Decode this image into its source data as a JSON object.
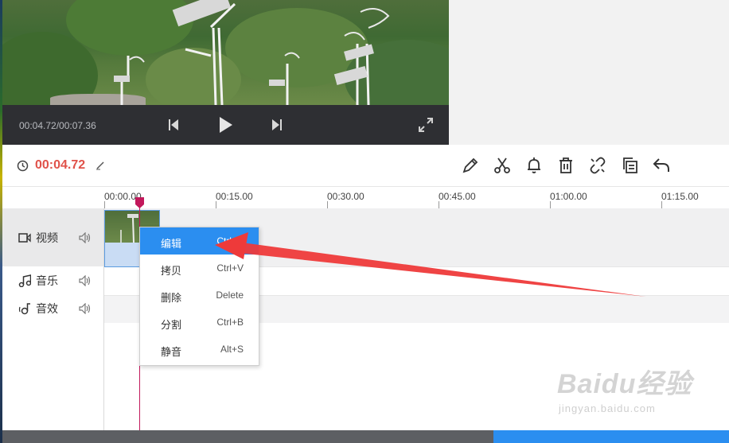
{
  "player": {
    "time_readout": "00:04.72/00:07.36",
    "controls": [
      "previous-icon",
      "play-icon",
      "next-icon",
      "fullscreen-icon"
    ]
  },
  "toolbar": {
    "current_time": "00:04.72",
    "tools": [
      "pencil-icon",
      "scissors-icon",
      "bell-icon",
      "trash-icon",
      "unlink-icon",
      "copy-icon",
      "undo-icon"
    ]
  },
  "ruler": {
    "ticks": [
      "00:00.00",
      "00:15.00",
      "00:30.00",
      "00:45.00",
      "01:00.00",
      "01:15.00"
    ]
  },
  "tracks": [
    {
      "label": "视频",
      "icon": "video-camera-icon"
    },
    {
      "label": "音乐",
      "icon": "music-note-icon"
    },
    {
      "label": "音效",
      "icon": "sound-effect-icon"
    }
  ],
  "context_menu": {
    "items": [
      {
        "label": "编辑",
        "shortcut": "Ctrl+E"
      },
      {
        "label": "拷贝",
        "shortcut": "Ctrl+V"
      },
      {
        "label": "删除",
        "shortcut": "Delete"
      },
      {
        "label": "分割",
        "shortcut": "Ctrl+B"
      },
      {
        "label": "静音",
        "shortcut": "Alt+S"
      }
    ],
    "active_index": 0
  },
  "colors": {
    "accent": "#2b8ef0",
    "time_red": "#e0524a",
    "playhead": "#c2185b",
    "annotation_arrow": "#ee3a3a"
  },
  "watermark": {
    "main": "Baidu经验",
    "sub": "jingyan.baidu.com"
  }
}
